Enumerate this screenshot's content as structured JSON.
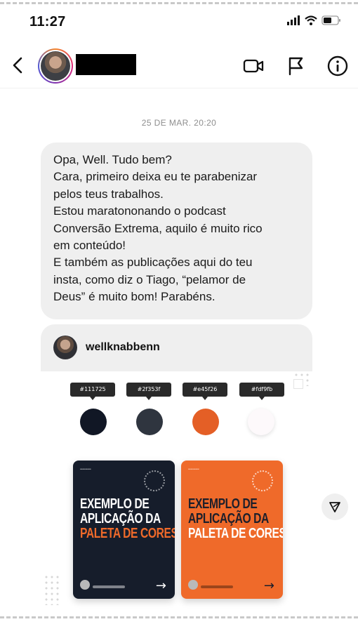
{
  "status_bar": {
    "time": "11:27"
  },
  "header": {
    "back_icon": "chevron-left-icon",
    "video_icon": "video-camera-icon",
    "flag_icon": "flag-icon",
    "info_icon": "info-circle-icon"
  },
  "conversation": {
    "date_label": "25 DE MAR. 20:20",
    "message_lines": [
      "Opa, Well. Tudo bem?",
      "Cara, primeiro deixa eu te parabenizar",
      "pelos teus trabalhos.",
      "Estou maratononando o podcast",
      "Conversão Extrema, aquilo é muito rico",
      "em conteúdo!",
      "E também as publicações aqui do teu",
      "insta, como diz o Tiago, “pelamor de",
      "Deus” é muito bom! Parabéns."
    ]
  },
  "shared_post": {
    "username": "wellknabbenn",
    "palette": [
      {
        "label": "#111725",
        "color": "#111725"
      },
      {
        "label": "#2f353f",
        "color": "#2f353f"
      },
      {
        "label": "#e45f26",
        "color": "#e45f26"
      },
      {
        "label": "#fdf9fb",
        "color": "#fdf9fb"
      }
    ],
    "cards": [
      {
        "lines": [
          "EXEMPLO DE",
          "APLICAÇÃO DA",
          "PALETA DE CORES"
        ],
        "arrow": "→"
      },
      {
        "lines": [
          "EXEMPLO DE",
          "APLICAÇÃO DA",
          "PALETA DE CORES"
        ],
        "arrow": "→"
      }
    ],
    "share_icon": "send-icon"
  },
  "colors": {
    "bubble": "#efefef",
    "accent_orange": "#ef6a2a",
    "navy": "#161d2b"
  }
}
